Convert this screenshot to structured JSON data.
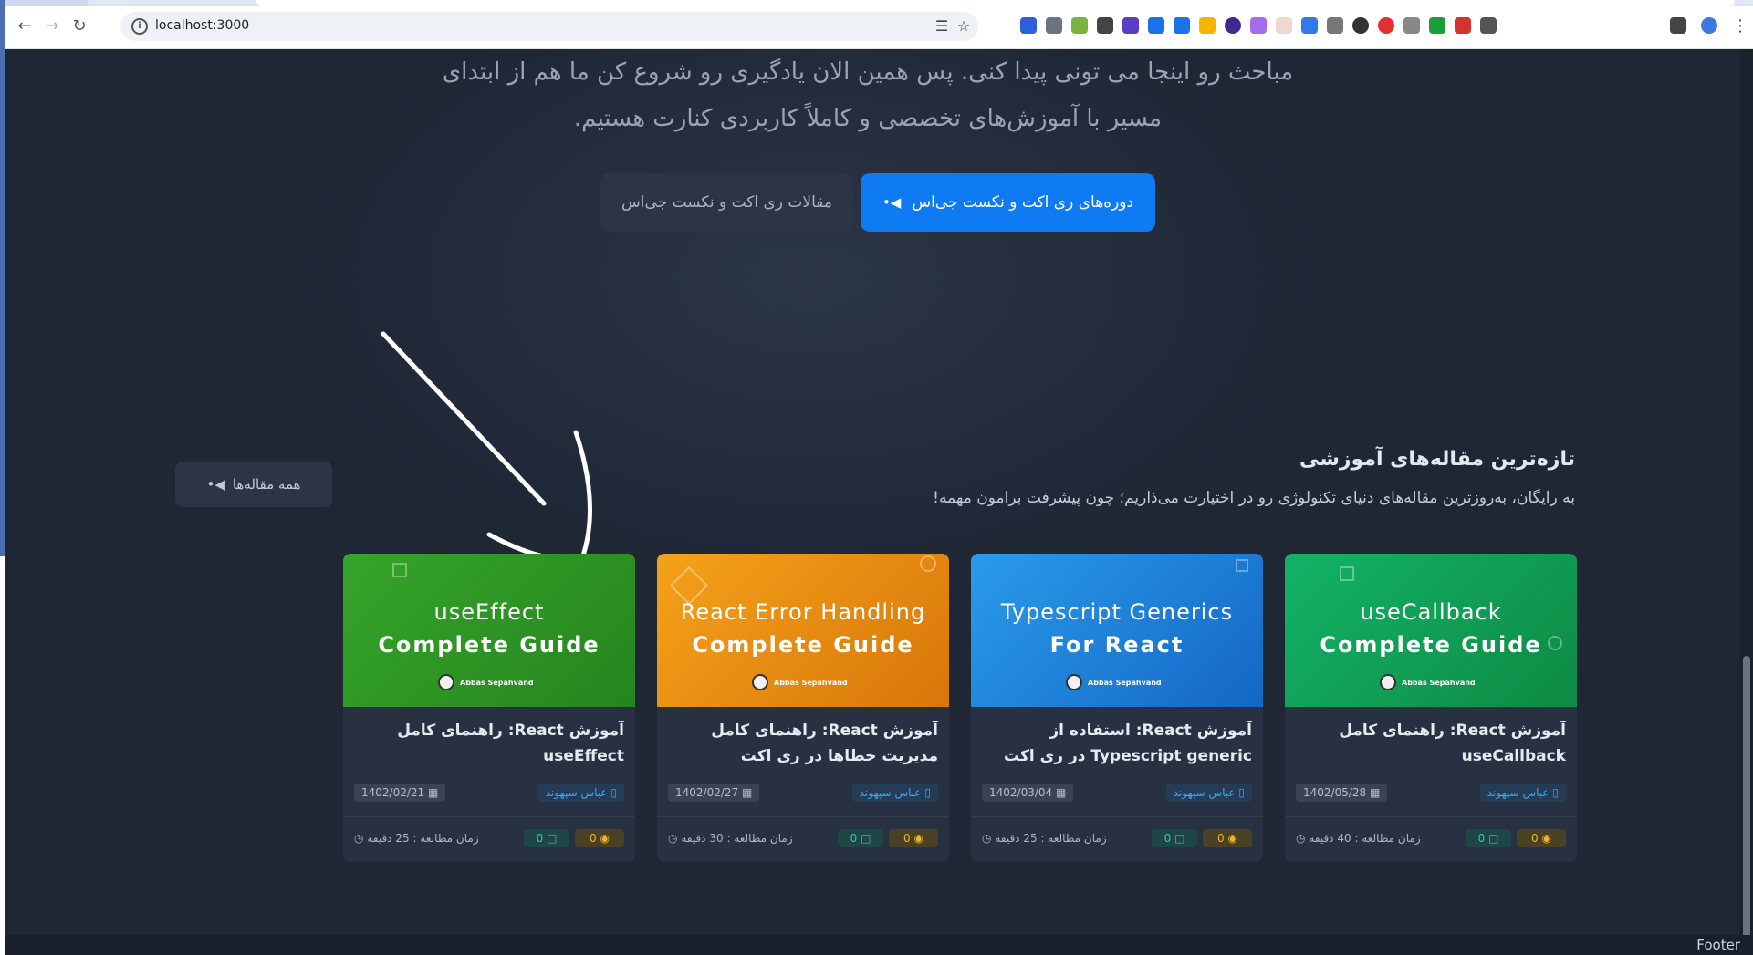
{
  "browser": {
    "url": "localhost:3000",
    "back_icon": "arrow-left-icon",
    "forward_icon": "arrow-right-icon",
    "reload_icon": "reload-icon"
  },
  "hero": {
    "line1": "مباحث رو اینجا می تونی پیدا کنی. پس همین الان یادگیری رو شروع کن ما هم از ابتدای",
    "line2": "مسیر با آموزش‌های تخصصی و کاملاً کاربردی کنارت هستیم.",
    "primary_button": "دوره‌های ری اکت و نکست جی‌اس",
    "secondary_button": "مقالات ری اکت و نکست جی‌اس"
  },
  "articles_section": {
    "title": "تازه‌ترین مقاله‌های آموزشی",
    "subtitle": "به رایگان، به‌روزترین مقاله‌های دنیای تکنولوژی رو در اختیارت می‌ذاریم؛ چون پیشرفت برامون مهمه!",
    "all_button": "همه مقاله‌ها"
  },
  "cards": [
    {
      "thumb_line1": "useCallback",
      "thumb_line2": "Complete Guide",
      "thumb_author": "Abbas Sepahvand",
      "title": "آموزش React: راهنمای کامل useCallback",
      "author": "عباس سپهوند",
      "date": "1402/05/28",
      "views": "0",
      "comments": "0",
      "read_time": "زمان مطالعه : 40 دقیقه",
      "color": "#14a85a"
    },
    {
      "thumb_line1": "Typescript  Generics",
      "thumb_line2": "For React",
      "thumb_author": "Abbas Sepahvand",
      "title": "آموزش React: استفاده از Typescript generic در ری اکت",
      "author": "عباس سپهوند",
      "date": "1402/03/04",
      "views": "0",
      "comments": "0",
      "read_time": "زمان مطالعه : 25 دقیقه",
      "color": "#1e88e5"
    },
    {
      "thumb_line1": "React Error Handling",
      "thumb_line2": "Complete Guide",
      "thumb_author": "Abbas Sepahvand",
      "title": "آموزش React: راهنمای کامل مدیریت خطاها در ری اکت",
      "author": "عباس سپهوند",
      "date": "1402/02/27",
      "views": "0",
      "comments": "0",
      "read_time": "زمان مطالعه : 30 دقیقه",
      "color": "#f08c10"
    },
    {
      "thumb_line1": "useEffect",
      "thumb_line2": "Complete Guide",
      "thumb_author": "Abbas Sepahvand",
      "title": "آموزش React: راهنمای کامل useEffect",
      "author": "عباس سپهوند",
      "date": "1402/02/21",
      "views": "0",
      "comments": "0",
      "read_time": "زمان مطالعه : 25 دقیقه",
      "color": "#2e9b2a"
    }
  ],
  "footer": {
    "text": "Footer"
  }
}
